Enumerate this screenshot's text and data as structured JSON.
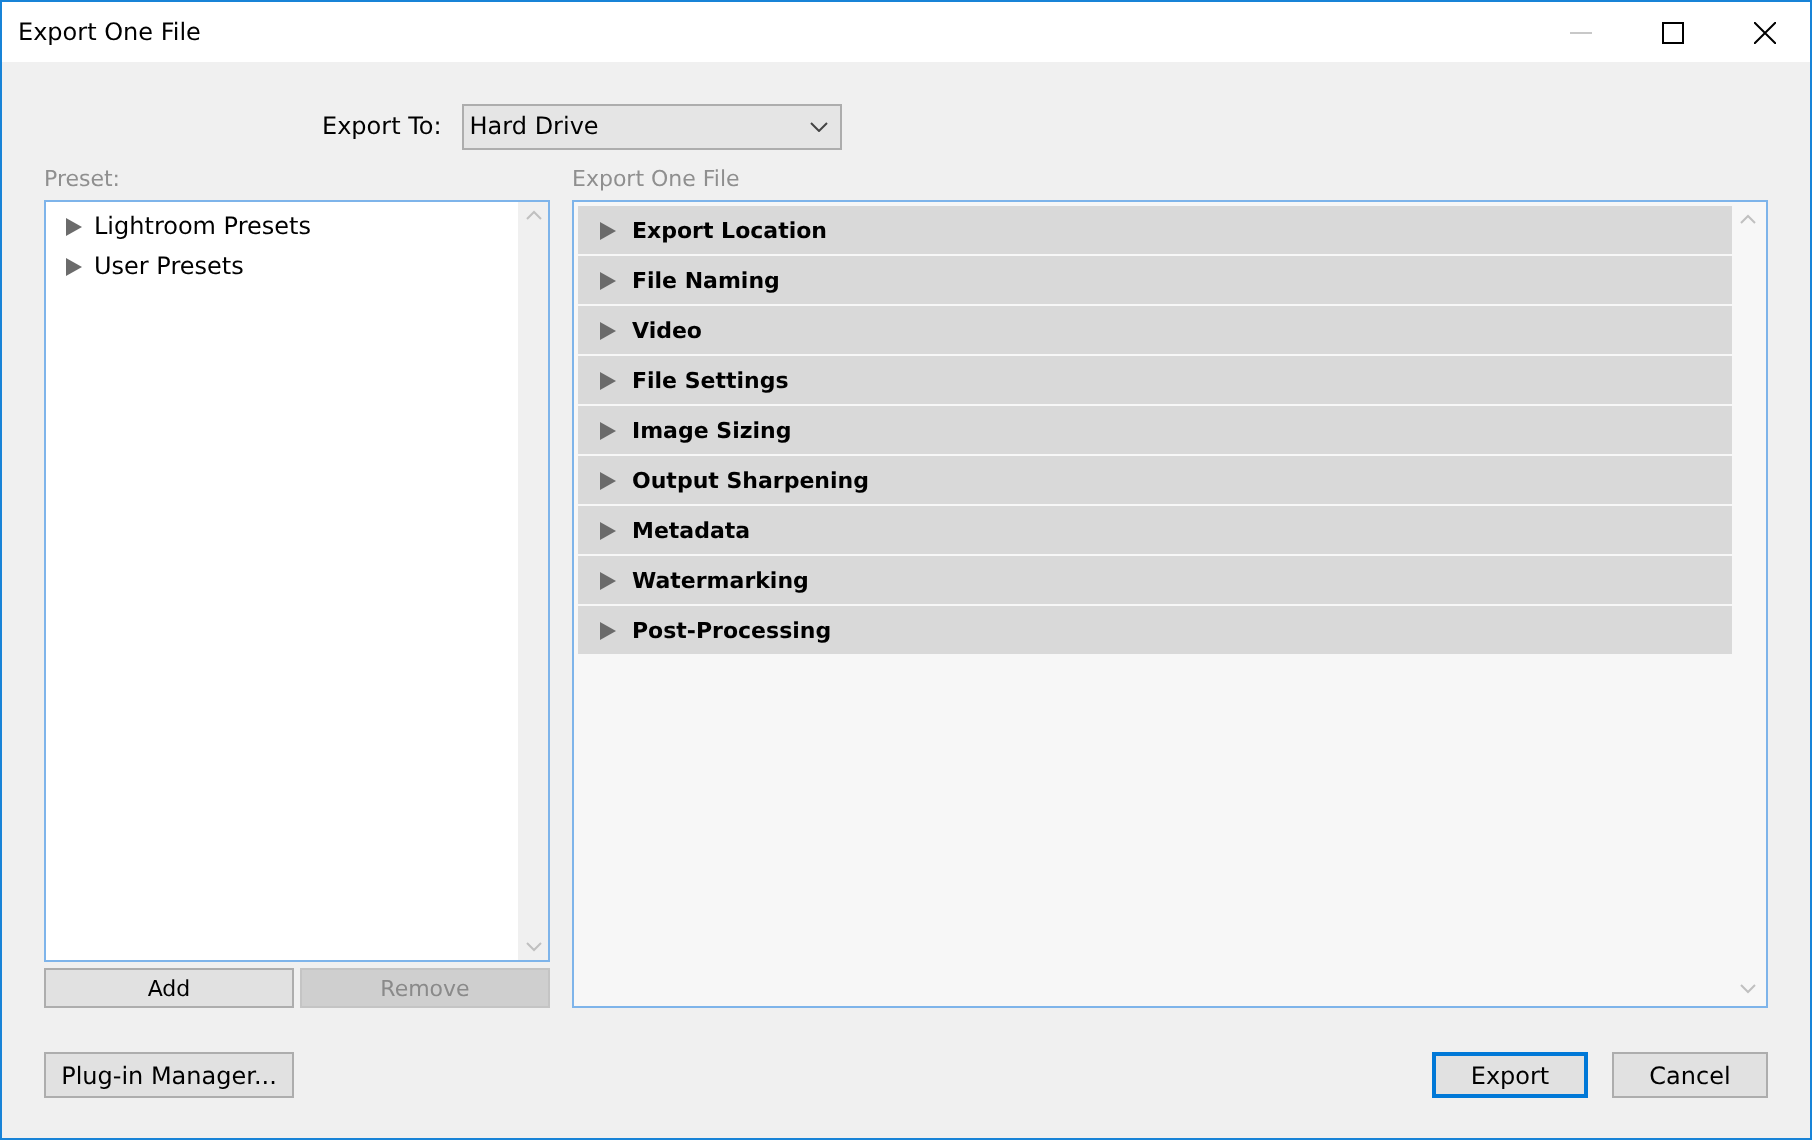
{
  "window": {
    "title": "Export One File",
    "minimize_disabled": true
  },
  "export_to": {
    "label": "Export To:",
    "value": "Hard Drive"
  },
  "preset": {
    "label": "Preset:",
    "items": [
      {
        "label": "Lightroom Presets",
        "expanded": false
      },
      {
        "label": "User Presets",
        "expanded": false
      }
    ],
    "buttons": [
      {
        "label": "Add",
        "disabled": false
      },
      {
        "label": "Remove",
        "disabled": true
      }
    ]
  },
  "sections_panel": {
    "label": "Export One File",
    "sections": [
      {
        "label": "Export Location",
        "expanded": false
      },
      {
        "label": "File Naming",
        "expanded": false
      },
      {
        "label": "Video",
        "expanded": false
      },
      {
        "label": "File Settings",
        "expanded": false
      },
      {
        "label": "Image Sizing",
        "expanded": false
      },
      {
        "label": "Output Sharpening",
        "expanded": false
      },
      {
        "label": "Metadata",
        "expanded": false
      },
      {
        "label": "Watermarking",
        "expanded": false
      },
      {
        "label": "Post-Processing",
        "expanded": false
      }
    ]
  },
  "footer": {
    "plugin_button": "Plug-in Manager...",
    "buttons": [
      {
        "label": "Export",
        "default": true
      },
      {
        "label": "Cancel",
        "default": false
      }
    ]
  }
}
